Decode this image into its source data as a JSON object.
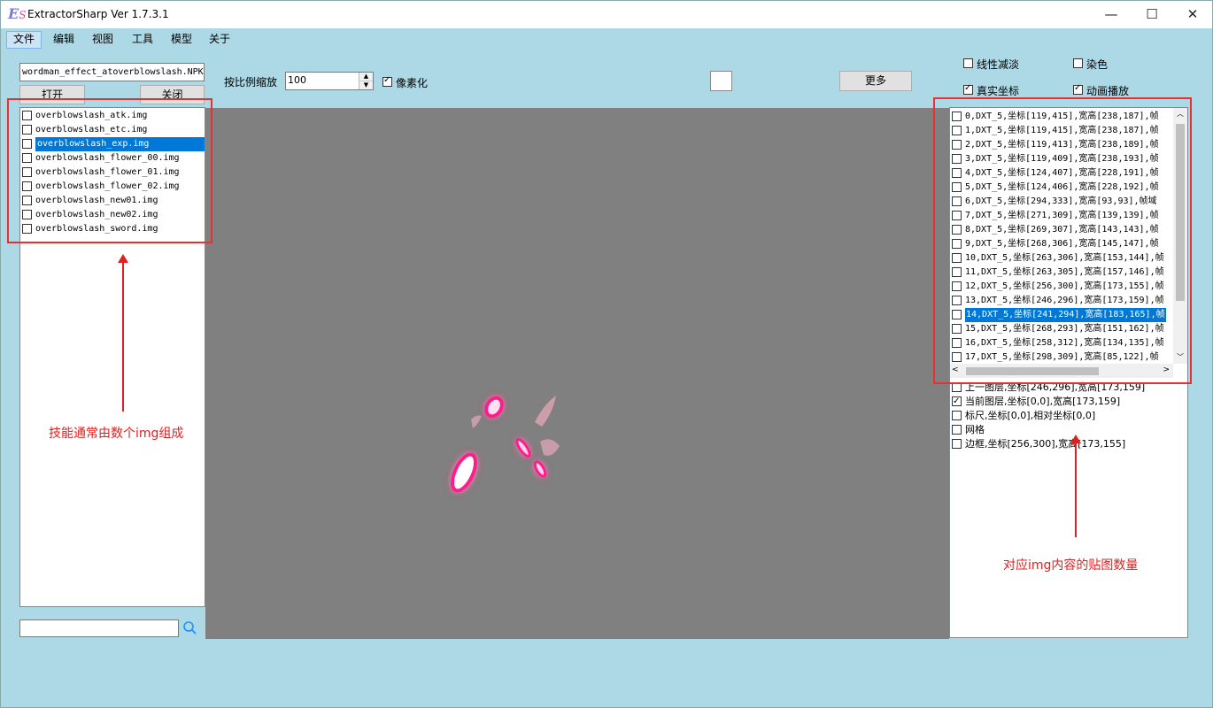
{
  "window": {
    "logo": "E",
    "logo_sub": "S",
    "title": "ExtractorSharp Ver 1.7.3.1",
    "minimize": "—",
    "maximize": "☐",
    "close": "✕"
  },
  "menu": {
    "items": [
      "文件",
      "编辑",
      "视图",
      "工具",
      "模型",
      "关于"
    ]
  },
  "left": {
    "npk_path": "wordman_effect_atoverblowslash.NPK",
    "open_label": "打开",
    "close_label": "关闭",
    "files": [
      {
        "name": "overblowslash_atk.img",
        "checked": false,
        "selected": false
      },
      {
        "name": "overblowslash_etc.img",
        "checked": false,
        "selected": false
      },
      {
        "name": "overblowslash_exp.img",
        "checked": false,
        "selected": true
      },
      {
        "name": "overblowslash_flower_00.img",
        "checked": false,
        "selected": false
      },
      {
        "name": "overblowslash_flower_01.img",
        "checked": false,
        "selected": false
      },
      {
        "name": "overblowslash_flower_02.img",
        "checked": false,
        "selected": false
      },
      {
        "name": "overblowslash_new01.img",
        "checked": false,
        "selected": false
      },
      {
        "name": "overblowslash_new02.img",
        "checked": false,
        "selected": false
      },
      {
        "name": "overblowslash_sword.img",
        "checked": false,
        "selected": false
      }
    ],
    "search_value": ""
  },
  "toolbar": {
    "scale_label": "按比例缩放",
    "scale_value": "100",
    "pixelate_label": "像素化",
    "more_label": "更多"
  },
  "options": {
    "linear_fade": "线性减淡",
    "dye": "染色",
    "real_coords": "真实坐标",
    "animate": "动画播放"
  },
  "frames": [
    {
      "text": "0,DXT_5,坐标[119,415],宽高[238,187],帧",
      "selected": false
    },
    {
      "text": "1,DXT_5,坐标[119,415],宽高[238,187],帧",
      "selected": false
    },
    {
      "text": "2,DXT_5,坐标[119,413],宽高[238,189],帧",
      "selected": false
    },
    {
      "text": "3,DXT_5,坐标[119,409],宽高[238,193],帧",
      "selected": false
    },
    {
      "text": "4,DXT_5,坐标[124,407],宽高[228,191],帧",
      "selected": false
    },
    {
      "text": "5,DXT_5,坐标[124,406],宽高[228,192],帧",
      "selected": false
    },
    {
      "text": "6,DXT_5,坐标[294,333],宽高[93,93],帧域",
      "selected": false
    },
    {
      "text": "7,DXT_5,坐标[271,309],宽高[139,139],帧",
      "selected": false
    },
    {
      "text": "8,DXT_5,坐标[269,307],宽高[143,143],帧",
      "selected": false
    },
    {
      "text": "9,DXT_5,坐标[268,306],宽高[145,147],帧",
      "selected": false
    },
    {
      "text": "10,DXT_5,坐标[263,306],宽高[153,144],帧",
      "selected": false
    },
    {
      "text": "11,DXT_5,坐标[263,305],宽高[157,146],帧",
      "selected": false
    },
    {
      "text": "12,DXT_5,坐标[256,300],宽高[173,155],帧",
      "selected": false
    },
    {
      "text": "13,DXT_5,坐标[246,296],宽高[173,159],帧",
      "selected": false
    },
    {
      "text": "14,DXT_5,坐标[241,294],宽高[183,165],帧",
      "selected": true
    },
    {
      "text": "15,DXT_5,坐标[268,293],宽高[151,162],帧",
      "selected": false
    },
    {
      "text": "16,DXT_5,坐标[258,312],宽高[134,135],帧",
      "selected": false
    },
    {
      "text": "17,DXT_5,坐标[298,309],宽高[85,122],帧",
      "selected": false
    }
  ],
  "layers": [
    {
      "text": "上一图层,坐标[246,296],宽高[173,159]",
      "checked": false
    },
    {
      "text": "当前图层,坐标[0,0],宽高[173,159]",
      "checked": true
    },
    {
      "text": "标尺,坐标[0,0],相对坐标[0,0]",
      "checked": false
    },
    {
      "text": "网格",
      "checked": false
    },
    {
      "text": "边框,坐标[256,300],宽高[173,155]",
      "checked": false
    }
  ],
  "annotations": {
    "left_note": "技能通常由数个img组成",
    "right_note": "对应img内容的贴图数量"
  },
  "colors": {
    "window_bg": "#add8e6",
    "selection": "#0078d7",
    "annotation_red": "#e02020",
    "canvas_bg": "#808080",
    "petal_glow": "#ff1a8c"
  }
}
